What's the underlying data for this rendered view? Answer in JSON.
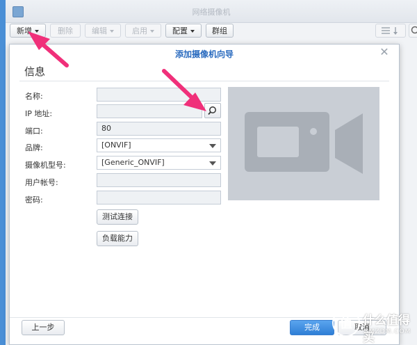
{
  "app": {
    "title": "网络摄像机"
  },
  "toolbar": {
    "new_label": "新增",
    "delete_label": "删除",
    "edit_label": "编辑",
    "enable_label": "启用",
    "config_label": "配置",
    "group_label": "群组"
  },
  "dialog": {
    "title": "添加摄像机向导",
    "section": "信息",
    "fields": {
      "name_label": "名称:",
      "ip_label": "IP 地址:",
      "port_label": "端口:",
      "port_value": "80",
      "brand_label": "品牌:",
      "brand_value": "[ONVIF]",
      "model_label": "摄像机型号:",
      "model_value": "[Generic_ONVIF]",
      "user_label": "用户帐号:",
      "password_label": "密码:"
    },
    "test_button": "测试连接",
    "capability_button": "负载能力",
    "prev_button": "上一步",
    "finish_button": "完成",
    "cancel_button": "取消"
  },
  "watermark": {
    "text": "什么值得买",
    "sub": "SMZDM.COM"
  },
  "icons": {
    "close": "close-icon",
    "search": "search-icon",
    "camera": "camera-icon"
  },
  "colors": {
    "accent": "#2a6bbf",
    "arrow": "#f0307a",
    "primary_button": "#3b8be0"
  }
}
